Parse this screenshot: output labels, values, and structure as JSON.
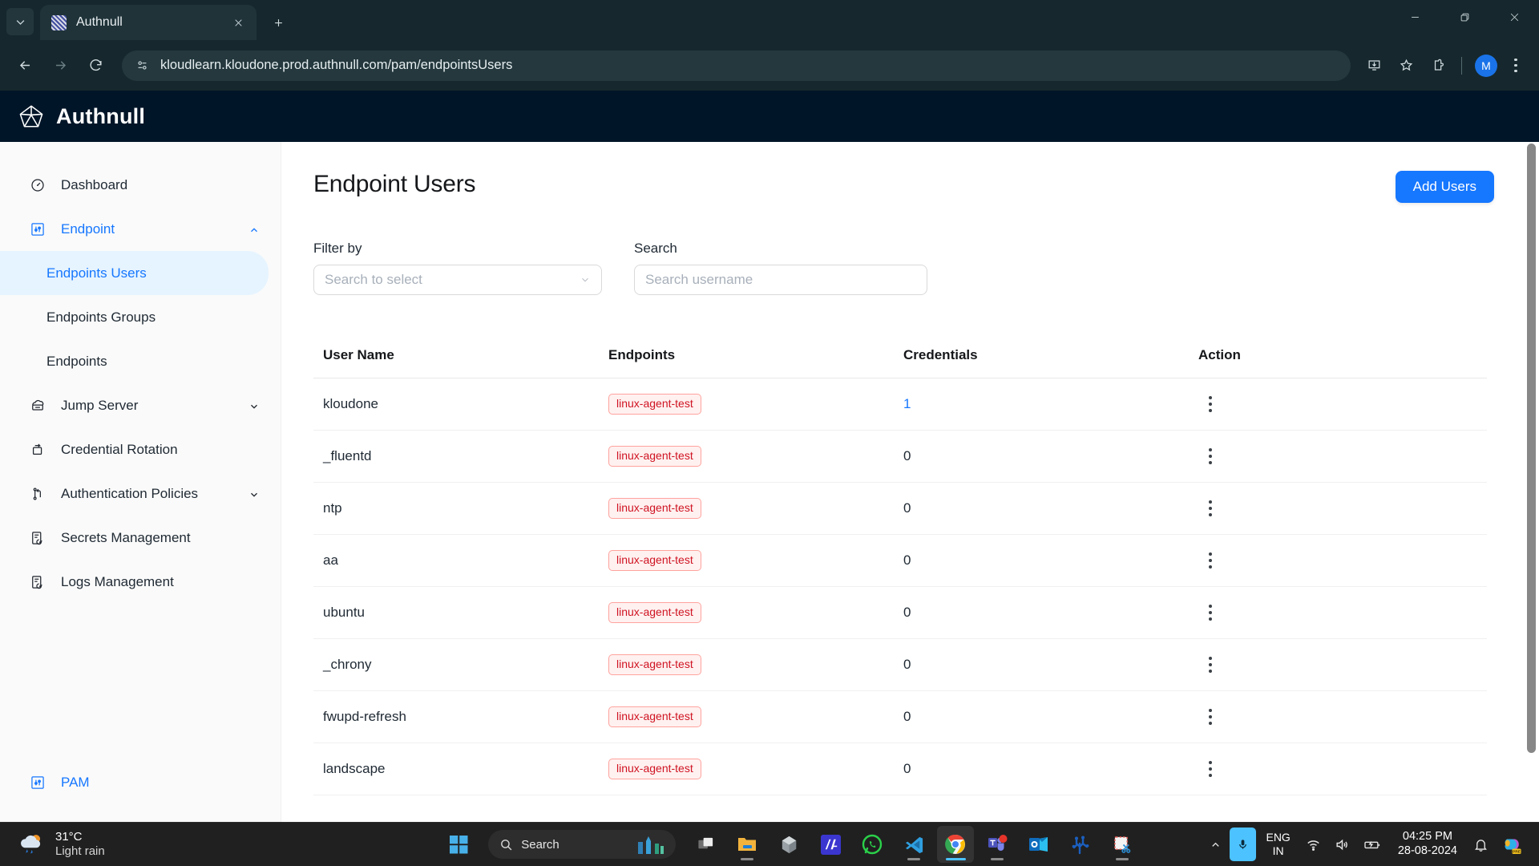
{
  "browser": {
    "tab": {
      "title": "Authnull",
      "favicon_icon": "authnull-favicon",
      "close_icon": "close-icon"
    },
    "tab_list_icon": "chevron-down-icon",
    "new_tab_icon": "plus-icon",
    "window_controls": {
      "minimize_icon": "minimize-icon",
      "maximize_icon": "restore-icon",
      "close_icon": "close-icon"
    },
    "nav": {
      "back_icon": "back-arrow-icon",
      "forward_icon": "forward-arrow-icon",
      "reload_icon": "reload-icon"
    },
    "omnibox": {
      "site_info_icon": "site-settings-icon",
      "url": "kloudlearn.kloudone.prod.authnull.com/pam/endpointsUsers"
    },
    "actions": {
      "install_icon": "install-app-icon",
      "bookmark_icon": "star-icon",
      "extensions_icon": "extensions-puzzle-icon",
      "profile_initial": "M",
      "menu_icon": "three-dot-menu-icon"
    }
  },
  "app": {
    "brand": {
      "name": "Authnull",
      "logo_icon": "authnull-pentagon-logo",
      "bar_color": "#001528"
    },
    "accent_color": "#1677ff"
  },
  "sidebar": {
    "items": [
      {
        "label": "Dashboard",
        "icon": "speedometer-icon",
        "expandable": false,
        "active": false
      },
      {
        "label": "Endpoint",
        "icon": "sliders-icon",
        "expandable": true,
        "expanded": true,
        "active": true,
        "chevron": "chevron-up-icon"
      },
      {
        "label": "Jump Server",
        "icon": "jump-server-icon",
        "expandable": true,
        "expanded": false,
        "active": false,
        "chevron": "chevron-down-icon"
      },
      {
        "label": "Credential Rotation",
        "icon": "rotate-icon",
        "expandable": false,
        "active": false
      },
      {
        "label": "Authentication Policies",
        "icon": "branch-policy-icon",
        "expandable": true,
        "expanded": false,
        "active": false,
        "chevron": "chevron-down-icon"
      },
      {
        "label": "Secrets Management",
        "icon": "shield-doc-icon",
        "expandable": false,
        "active": false
      },
      {
        "label": "Logs Management",
        "icon": "shield-doc-icon",
        "expandable": false,
        "active": false
      }
    ],
    "sub_items": [
      {
        "label": "Endpoints Users",
        "selected": true
      },
      {
        "label": "Endpoints Groups",
        "selected": false
      },
      {
        "label": "Endpoints",
        "selected": false
      }
    ],
    "bottom": {
      "label": "PAM",
      "icon": "sliders-icon",
      "active": true
    }
  },
  "main": {
    "title": "Endpoint Users",
    "add_users_label": "Add Users",
    "filter": {
      "label": "Filter by",
      "placeholder": "Search to select",
      "value": "",
      "caret_icon": "chevron-down-icon"
    },
    "search": {
      "label": "Search",
      "placeholder": "Search username",
      "value": ""
    },
    "table": {
      "columns": [
        "User Name",
        "Endpoints",
        "Credentials",
        "Action"
      ],
      "row_action_icon": "vertical-dots-icon",
      "rows": [
        {
          "user_name": "kloudone",
          "endpoint": "linux-agent-test",
          "credentials": "1",
          "credentials_link": true
        },
        {
          "user_name": "_fluentd",
          "endpoint": "linux-agent-test",
          "credentials": "0",
          "credentials_link": false
        },
        {
          "user_name": "ntp",
          "endpoint": "linux-agent-test",
          "credentials": "0",
          "credentials_link": false
        },
        {
          "user_name": "aa",
          "endpoint": "linux-agent-test",
          "credentials": "0",
          "credentials_link": false
        },
        {
          "user_name": "ubuntu",
          "endpoint": "linux-agent-test",
          "credentials": "0",
          "credentials_link": false
        },
        {
          "user_name": "_chrony",
          "endpoint": "linux-agent-test",
          "credentials": "0",
          "credentials_link": false
        },
        {
          "user_name": "fwupd-refresh",
          "endpoint": "linux-agent-test",
          "credentials": "0",
          "credentials_link": false
        },
        {
          "user_name": "landscape",
          "endpoint": "linux-agent-test",
          "credentials": "0",
          "credentials_link": false
        }
      ],
      "tag_colors": {
        "bg": "#fff1f0",
        "border": "#ffa39e",
        "text": "#cf1322"
      }
    }
  },
  "taskbar": {
    "weather": {
      "temperature": "31°C",
      "condition": "Light rain",
      "icon": "rain-cloud-sun-icon"
    },
    "start_icon": "windows-start-icon",
    "search": {
      "placeholder": "Search",
      "icon": "search-icon",
      "art_icon": "skyline-art-icon"
    },
    "apps": [
      {
        "name": "task-view-icon",
        "running": false,
        "active": false
      },
      {
        "name": "file-explorer-icon",
        "running": true,
        "active": false
      },
      {
        "name": "3d-viewer-icon",
        "running": false,
        "active": false
      },
      {
        "name": "ia-app-icon",
        "running": false,
        "active": false
      },
      {
        "name": "whatsapp-icon",
        "running": false,
        "active": false
      },
      {
        "name": "vscode-icon",
        "running": true,
        "active": false
      },
      {
        "name": "chrome-icon",
        "running": true,
        "active": true
      },
      {
        "name": "microsoft-teams-icon",
        "running": true,
        "active": false
      },
      {
        "name": "outlook-icon",
        "running": false,
        "active": false
      },
      {
        "name": "coral-app-icon",
        "running": false,
        "active": false
      },
      {
        "name": "snipping-tool-icon",
        "running": true,
        "active": false
      }
    ],
    "tray": {
      "overflow_icon": "chevron-up-icon",
      "mic_icon": "microphone-icon",
      "language_primary": "ENG",
      "language_secondary": "IN",
      "wifi_icon": "wifi-icon",
      "volume_icon": "speaker-icon",
      "battery_icon": "battery-charging-icon",
      "time": "04:25 PM",
      "date": "28-08-2024",
      "notifications_icon": "bell-icon",
      "copilot_icon": "copilot-icon",
      "copilot_badge": "PRE"
    }
  }
}
